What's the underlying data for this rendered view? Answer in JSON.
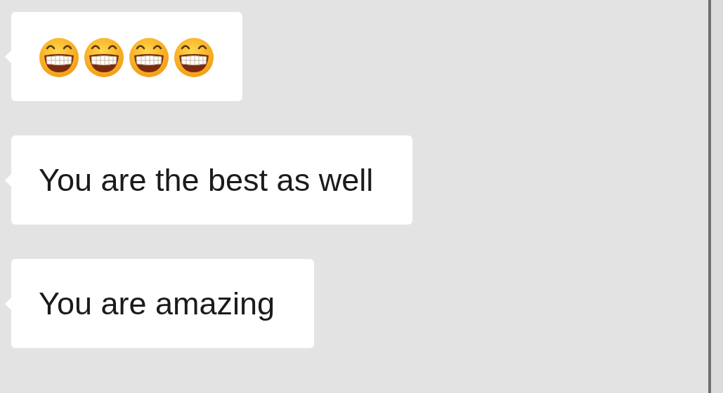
{
  "messages": [
    {
      "kind": "stickers",
      "stickers": [
        {
          "kind": "grin"
        },
        {
          "kind": "grin"
        },
        {
          "kind": "grin"
        },
        {
          "kind": "grin"
        }
      ]
    },
    {
      "kind": "text",
      "text": "You are the best as well"
    },
    {
      "kind": "text",
      "text": "You are amazing"
    }
  ]
}
